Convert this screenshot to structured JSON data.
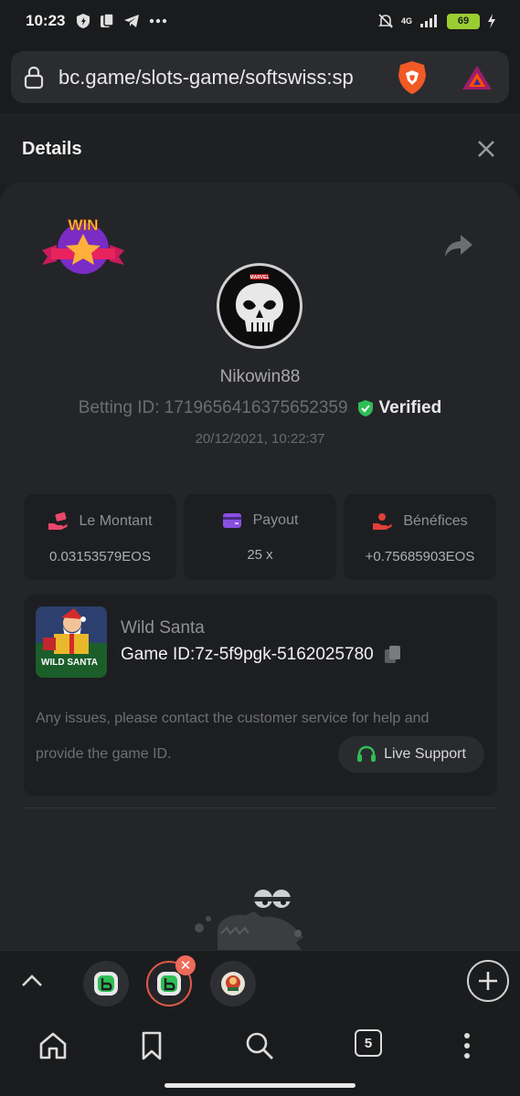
{
  "status_bar": {
    "time": "10:23",
    "network": "4G",
    "battery": "69"
  },
  "browser": {
    "url": "bc.game/slots-game/softswiss:sp",
    "tab_count": "5"
  },
  "details": {
    "title": "Details",
    "badge_text": "WIN",
    "avatar_text": "MARVEL",
    "username": "Nikowin88",
    "betting_id": "Betting ID: 1719656416375652359",
    "verified_label": "Verified",
    "date": "20/12/2021, 10:22:37",
    "stats": [
      {
        "label": "Le Montant",
        "value": "0.03153579EOS"
      },
      {
        "label": "Payout",
        "value": "25 x"
      },
      {
        "label": "Bénéfices",
        "value": "+0.75685903EOS"
      }
    ],
    "game": {
      "name": "Wild Santa",
      "game_id": "Game ID:7z-5f9pgk-5162025780",
      "thumb_text": "WILD SANTA"
    },
    "note_line1": "Any issues, please contact the customer service for help and",
    "note_line2": "provide the game ID.",
    "live_support": "Live Support"
  },
  "colors": {
    "accent_green": "#2fbd55",
    "stat_icon_pink": "#e8486b",
    "stat_icon_purple": "#8a4fe0",
    "stat_icon_red": "#e0403a",
    "close_badge": "#ee6b5b"
  }
}
